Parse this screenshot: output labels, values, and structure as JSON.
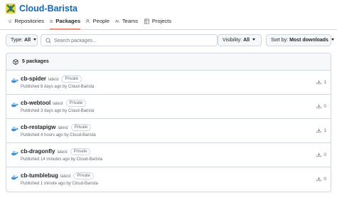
{
  "org": {
    "name": "Cloud-Barista"
  },
  "tabs": [
    {
      "label": "Repositories",
      "icon": "repo-icon"
    },
    {
      "label": "Packages",
      "icon": "package-icon",
      "active": true
    },
    {
      "label": "People",
      "icon": "person-icon"
    },
    {
      "label": "Teams",
      "icon": "people-icon"
    },
    {
      "label": "Projects",
      "icon": "table-icon"
    }
  ],
  "filters": {
    "type_label": "Type:",
    "type_value": "All",
    "search_placeholder": "Search packages...",
    "visibility_label": "Visibility:",
    "visibility_value": "All",
    "sort_label": "Sort by:",
    "sort_value": "Most downloads"
  },
  "list": {
    "count_label": "5 packages",
    "packages": [
      {
        "name": "cb-spider",
        "tag": "latest",
        "visibility": "Private",
        "meta": "Published 8 days ago by Cloud-Barista",
        "downloads": "1",
        "icon": "docker-icon"
      },
      {
        "name": "cb-webtool",
        "tag": "latest",
        "visibility": "Private",
        "meta": "Published 3 days ago by Cloud-Barista",
        "downloads": "0",
        "icon": "docker-icon"
      },
      {
        "name": "cb-restapigw",
        "tag": "latest",
        "visibility": "Private",
        "meta": "Published 4 hours ago by Cloud-Barista",
        "downloads": "1",
        "icon": "docker-icon"
      },
      {
        "name": "cb-dragonfly",
        "tag": "latest",
        "visibility": "Private",
        "meta": "Published 14 minutes ago by Cloud-Barista",
        "downloads": "0",
        "icon": "docker-icon"
      },
      {
        "name": "cb-tumblebug",
        "tag": "latest",
        "visibility": "Private",
        "meta": "Published 1 minute ago by Cloud-Barista",
        "downloads": "0",
        "icon": "docker-icon"
      }
    ]
  },
  "colors": {
    "link": "#0969da",
    "active_tab_underline": "#fd8c73",
    "docker_blue": "#2496ed",
    "logo_yellow": "#f3d04a"
  }
}
